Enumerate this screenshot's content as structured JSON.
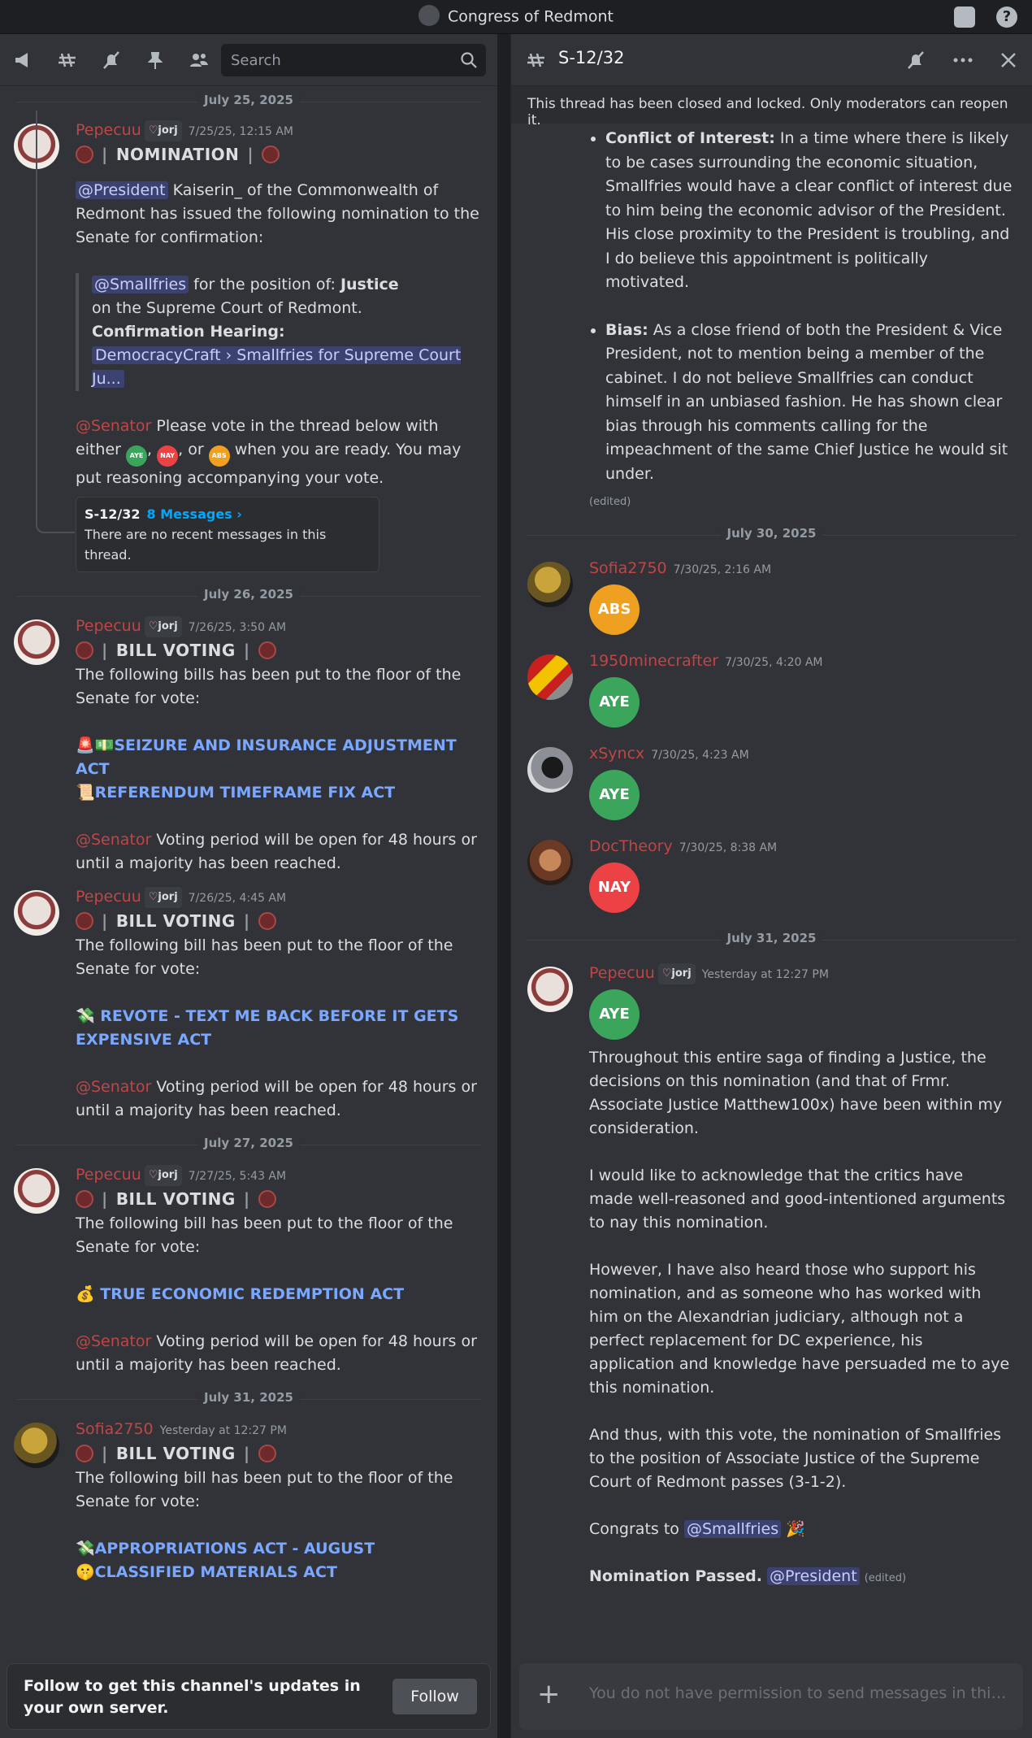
{
  "window": {
    "title": "Congress of Redmont"
  },
  "left": {
    "search_placeholder": "Search",
    "date1": "July 25, 2025",
    "m1": {
      "user": "Pepecuu",
      "tag": "jorj",
      "time": "7/25/25, 12:15 AM",
      "header": "NOMINATION",
      "mention_president": "@President",
      "p1": " Kaiserin_ of the Commonwealth of Redmont has issued the following nomination to the Senate for confirmation:",
      "mention_smallfries": "@Smallfries",
      "q1": " for the position of: ",
      "q1b": "Justice",
      "q2": "on the Supreme Court of Redmont.",
      "q3": "Confirmation Hearing:",
      "chan1": "DemocracyCraft",
      "chan_sep": " › ",
      "chan2": "Smallfries for Supreme Court Ju...",
      "role_senator": "@Senator",
      "p2a": " Please vote in the thread below with either ",
      "aye": "AYE",
      "p2b": ", ",
      "nay": "NAY",
      "p2c": ", or ",
      "abs": "ABS",
      "p2d": " when you are ready. You may put reasoning accompanying your vote.",
      "thread_name": "S-12/32",
      "thread_count": "8 Messages ›",
      "thread_empty": "There are no recent messages in this thread."
    },
    "date2": "July 26, 2025",
    "m2": {
      "user": "Pepecuu",
      "tag": "jorj",
      "time": "7/26/25, 3:50 AM",
      "header": "BILL VOTING",
      "p1": "The following bills has been put to the floor of the Senate for vote:",
      "bill1_emoji": "🚨💵",
      "bill1": "SEIZURE AND INSURANCE ADJUSTMENT ACT",
      "bill2_emoji": "📜",
      "bill2": "REFERENDUM TIMEFRAME FIX ACT",
      "role_senator": "@Senator",
      "p2": " Voting period will be open for 48 hours or until a majority has been reached."
    },
    "m3": {
      "user": "Pepecuu",
      "tag": "jorj",
      "time": "7/26/25, 4:45 AM",
      "header": "BILL VOTING",
      "p1": "The following bill has been put to the floor of the Senate for vote:",
      "bill_emoji": "💸",
      "bill": " REVOTE - TEXT ME BACK BEFORE IT GETS EXPENSIVE ACT",
      "role_senator": "@Senator",
      "p2": " Voting period will be open for 48 hours or until a majority has been reached."
    },
    "date3": "July 27, 2025",
    "m4": {
      "user": "Pepecuu",
      "tag": "jorj",
      "time": "7/27/25, 5:43 AM",
      "header": "BILL VOTING",
      "p1": "The following bill has been put to the floor of the Senate for vote:",
      "bill_emoji": "💰",
      "bill": "  TRUE ECONOMIC REDEMPTION ACT",
      "role_senator": "@Senator",
      "p2": " Voting period will be open for 48 hours or until a majority has been reached."
    },
    "date4": "July 31, 2025",
    "m5": {
      "user": "Sofia2750",
      "time": "Yesterday at 12:27 PM",
      "header": "BILL VOTING",
      "p1": "The following bill has been put to the floor of the Senate for vote:",
      "bill1_emoji": "💸",
      "bill1": "APPROPRIATIONS ACT - AUGUST",
      "bill2_emoji": "🤫",
      "bill2": "CLASSIFIED MATERIALS ACT"
    },
    "follow_text": "Follow to get this channel's updates in your own server.",
    "follow_button": "Follow"
  },
  "right": {
    "thread_title": "S-12/32",
    "locked_notice": "This thread has been closed and locked. Only moderators can reopen it.",
    "coi_label": "Conflict of Interest:",
    "coi_text": " In a time where there is likely to be cases surrounding the economic situation, Smallfries would have a clear conflict of interest due to him being the economic advisor of the President. His close proximity to the President is troubling, and I do believe this appointment is politically motivated.",
    "bias_label": "Bias:",
    "bias_text": " As a close friend of both the President & Vice President, not to mention being a member of the cabinet. I do not believe Smallfries can conduct himself in an unbiased fashion. He has shown clear bias through his comments calling for the impeachment of the same Chief Justice he would sit under.",
    "edited": "(edited)",
    "date1": "July 30, 2025",
    "votes": [
      {
        "user": "Sofia2750",
        "time": "7/30/25, 2:16 AM",
        "vote": "ABS"
      },
      {
        "user": "1950minecrafter",
        "time": "7/30/25, 4:20 AM",
        "vote": "AYE"
      },
      {
        "user": "xSyncx",
        "time": "7/30/25, 4:23 AM",
        "vote": "AYE"
      },
      {
        "user": "DocTheory",
        "time": "7/30/25, 8:38 AM",
        "vote": "NAY"
      }
    ],
    "date2": "July 31, 2025",
    "final": {
      "user": "Pepecuu",
      "tag": "jorj",
      "time": "Yesterday at 12:27 PM",
      "vote": "AYE",
      "p1": "Throughout this entire saga of finding a Justice, the decisions on this nomination (and that of Frmr. Associate Justice Matthew100x) have been within my consideration.",
      "p2": "I would like to acknowledge that the critics have made well-reasoned and good-intentioned arguments to nay this nomination.",
      "p3": "However, I have also heard those who support his nomination, and as someone who has worked with him on the Alexandrian judiciary, although not a perfect replacement for DC experience, his application and knowledge have persuaded me to aye this nomination.",
      "p4": "And thus, with this vote, the nomination of Smallfries to the position of Associate Justice of the Supreme Court of Redmont passes (3-1-2).",
      "p5": "Congrats to ",
      "mention": "@Smallfries",
      "p5_emoji": "🎉",
      "p6": "Nomination Passed.",
      "mention2": "@President",
      "edited": "(edited)"
    },
    "composer_placeholder": "You do not have permission to send messages in this c..."
  }
}
